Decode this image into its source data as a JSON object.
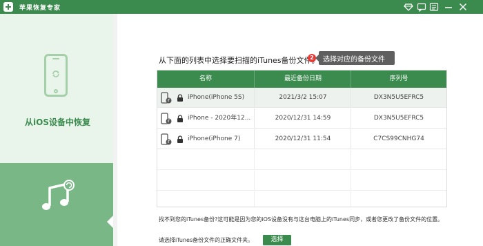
{
  "app": {
    "title": "苹果恢复专家",
    "logo_icon": "plus-logo-icon",
    "controls": [
      "diamond-icon",
      "feedback-icon",
      "menu-icon",
      "minimize-icon",
      "close-icon"
    ],
    "accent_color": "#3b8a4e"
  },
  "sidebar": {
    "mode_label": "从iOS设备中恢复",
    "mode_icon": "phone-refresh-icon",
    "itunes_icon": "music-note-icon"
  },
  "main": {
    "heading": "从下面的列表中选择要扫描的iTunes备份文件。",
    "step_badge": "2",
    "tooltip": "选择对应的备份文件"
  },
  "table": {
    "columns": [
      "名称",
      "最近备份日期",
      "序列号"
    ],
    "rows": [
      {
        "name": "iPhone(iPhone 5S)",
        "date": "2021/3/2 15:07",
        "serial": "DX3N5U5EFRC5"
      },
      {
        "name": "iPhone - 2020年12...",
        "date": "2020/12/31 14:59",
        "serial": "DX3N5U5EFRC5"
      },
      {
        "name": "iPhone(iPhone 7)",
        "date": "2020/12/31 11:54",
        "serial": "C7CS99CNHG74"
      }
    ]
  },
  "footer": {
    "note": "找不到您的iTunes备份?这可能是因为您的iOS设备没有与这台电脑上的iTunes同步，或者您更改了备份文件的位置。",
    "select_label": "请选择iTunes备份文件的正确文件夹。",
    "select_button": "选择"
  }
}
